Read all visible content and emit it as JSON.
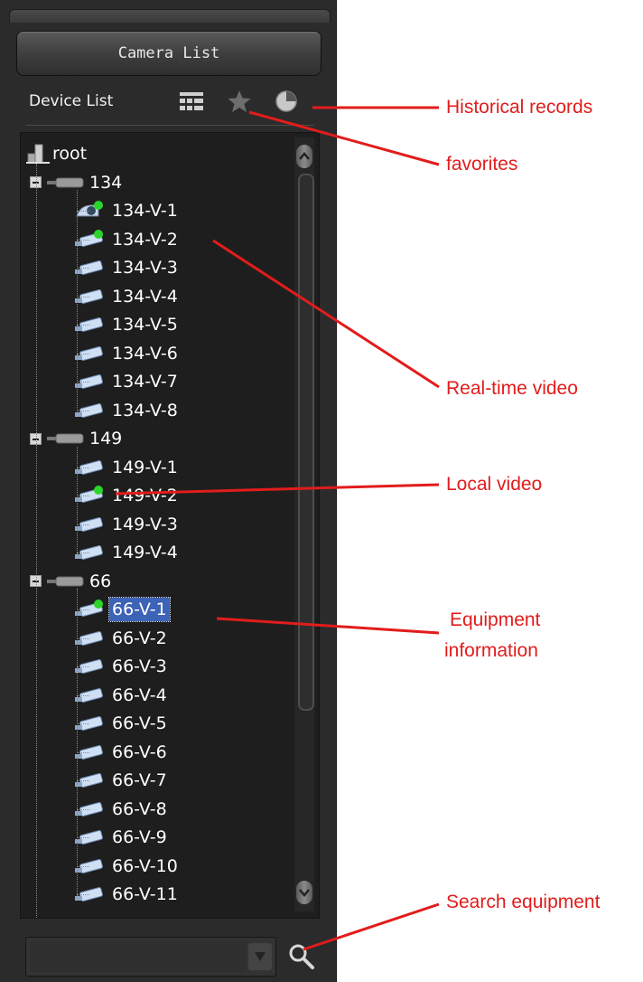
{
  "panel": {
    "title_button": "Camera List",
    "device_list_label": "Device List"
  },
  "tree": {
    "root": "root",
    "groups": [
      {
        "label": "134",
        "children": [
          "134-V-1",
          "134-V-2",
          "134-V-3",
          "134-V-4",
          "134-V-5",
          "134-V-6",
          "134-V-7",
          "134-V-8"
        ]
      },
      {
        "label": "149",
        "children": [
          "149-V-1",
          "149-V-2",
          "149-V-3",
          "149-V-4"
        ]
      },
      {
        "label": "66",
        "children": [
          "66-V-1",
          "66-V-2",
          "66-V-3",
          "66-V-4",
          "66-V-5",
          "66-V-6",
          "66-V-7",
          "66-V-8",
          "66-V-9",
          "66-V-10",
          "66-V-11"
        ]
      }
    ],
    "selected_item": "66-V-1"
  },
  "search": {
    "value": ""
  },
  "annotations": {
    "historical": "Historical records",
    "favorites": "favorites",
    "realtime": "Real-time video",
    "local": "Local video",
    "equipment_line1": "Equipment",
    "equipment_line2": "information",
    "search": "Search equipment"
  },
  "colors": {
    "annotation": "#e21c1c",
    "panel_bg": "#2b2b2b",
    "selection": "#3d63b6",
    "status_dot": "#2bd62b"
  }
}
